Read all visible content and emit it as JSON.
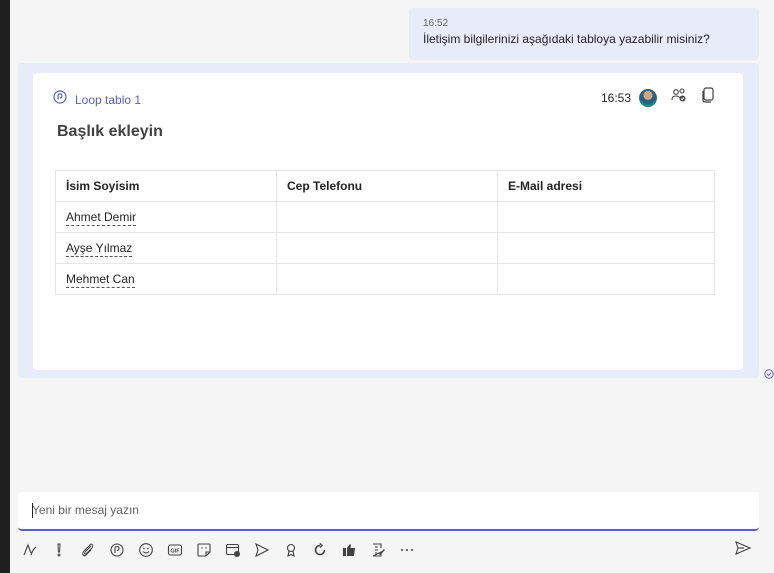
{
  "message": {
    "time": "16:52",
    "text": "İletişim bilgilerinizi aşağıdaki tabloya yazabilir misiniz?"
  },
  "loop": {
    "title": "Loop tablo 1",
    "time": "16:53",
    "heading": "Başlık ekleyin",
    "table": {
      "headers": [
        "İsim Soyisim",
        "Cep Telefonu",
        "E-Mail adresi"
      ],
      "rows": [
        [
          "Ahmet Demir",
          "",
          ""
        ],
        [
          "Ayşe Yılmaz",
          "",
          ""
        ],
        [
          "Mehmet Can",
          "",
          ""
        ]
      ]
    }
  },
  "compose": {
    "placeholder": "Yeni bir mesaj yazın"
  },
  "toolbar": {
    "icons": [
      "format-icon",
      "important-icon",
      "attach-icon",
      "loop-icon",
      "emoji-icon",
      "gif-icon",
      "sticker-icon",
      "meet-icon",
      "praise-icon",
      "praise-badge-icon",
      "loop-component-icon",
      "updates-icon",
      "approvals-icon",
      "more-icon"
    ]
  },
  "colors": {
    "accent": "#5b5fc7",
    "bubble": "#e8ebfa",
    "background": "#f5f5f5"
  }
}
